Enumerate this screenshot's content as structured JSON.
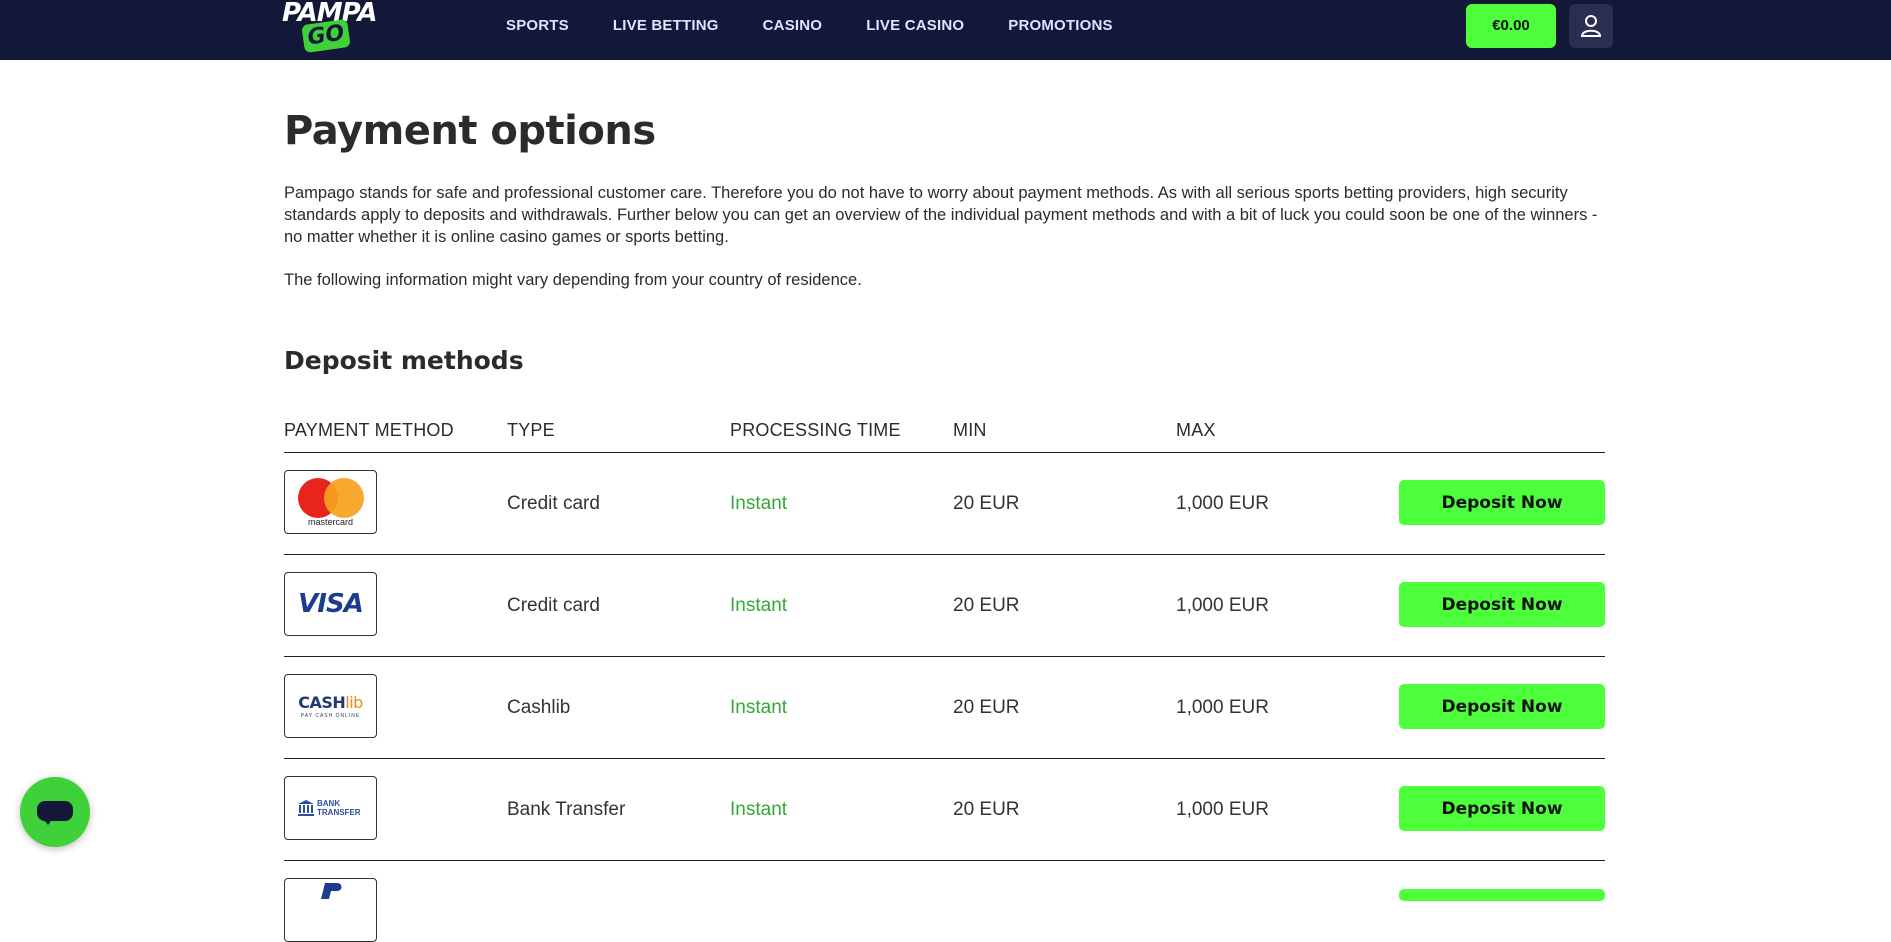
{
  "brand": {
    "logo_top": "PAMPA",
    "logo_bottom": "GO"
  },
  "nav": {
    "items": [
      {
        "label": "SPORTS"
      },
      {
        "label": "LIVE BETTING"
      },
      {
        "label": "CASINO"
      },
      {
        "label": "LIVE CASINO"
      },
      {
        "label": "PROMOTIONS"
      }
    ]
  },
  "account": {
    "balance": "€0.00",
    "user_icon": "user-icon"
  },
  "page": {
    "title": "Payment options",
    "intro": "Pampago stands for safe and professional customer care. Therefore you do not have to worry about payment methods. As with all serious sports betting providers, high security standards apply to deposits and withdrawals. Further below you can get an overview of the individual payment methods and with a bit of luck you could soon be one of the winners - no matter whether it is online casino games or sports betting.",
    "notice": "The following information might vary depending from your country of residence."
  },
  "deposit": {
    "title": "Deposit methods",
    "columns": [
      "PAYMENT METHOD",
      "TYPE",
      "PROCESSING TIME",
      "MIN",
      "MAX"
    ],
    "rows": [
      {
        "method": "mastercard",
        "logo_text": "mastercard",
        "type": "Credit card",
        "time": "Instant",
        "min": "20 EUR",
        "max": "1,000 EUR",
        "button": "Deposit Now"
      },
      {
        "method": "visa",
        "logo_text": "VISA",
        "type": "Credit card",
        "time": "Instant",
        "min": "20 EUR",
        "max": "1,000 EUR",
        "button": "Deposit Now"
      },
      {
        "method": "cashlib",
        "logo_text_a": "CASH",
        "logo_text_b": "lib",
        "logo_sub": "PAY CASH ONLINE",
        "type": "Cashlib",
        "time": "Instant",
        "min": "20 EUR",
        "max": "1,000 EUR",
        "button": "Deposit Now"
      },
      {
        "method": "bank-transfer",
        "logo_text_a": "BANK",
        "logo_text_b": "TRANSFER",
        "type": "Bank Transfer",
        "time": "Instant",
        "min": "20 EUR",
        "max": "1,000 EUR",
        "button": "Deposit Now"
      }
    ]
  },
  "colors": {
    "header_bg": "#141838",
    "accent_green": "#4cff3a",
    "instant_green": "#34a836"
  },
  "chat": {
    "icon": "chat-icon"
  }
}
